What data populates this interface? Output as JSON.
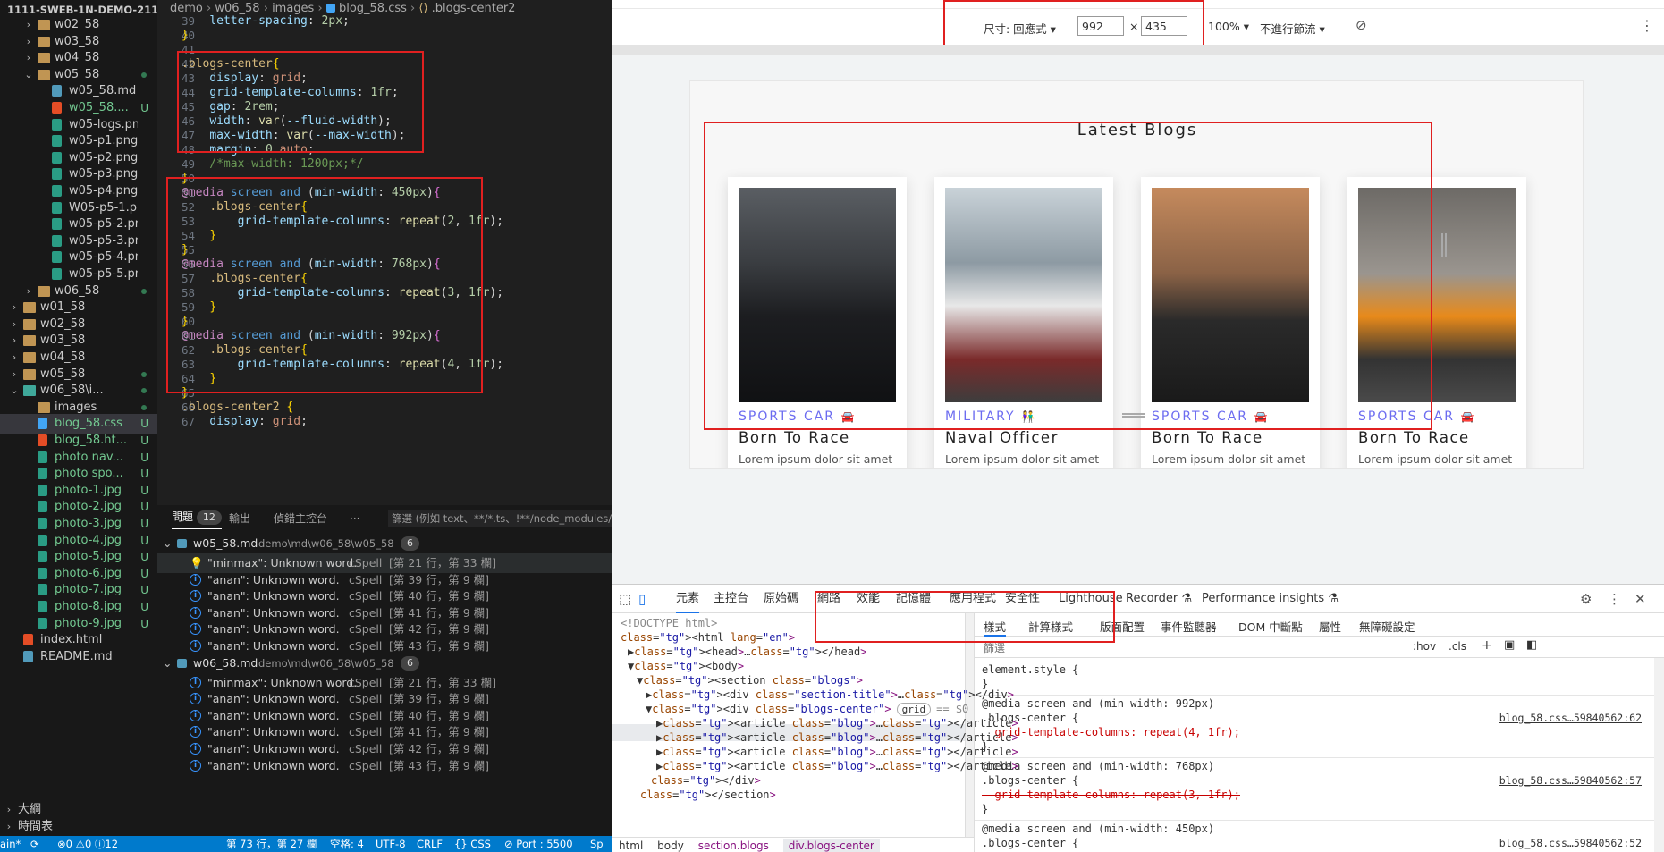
{
  "vscode": {
    "explorer": {
      "root": "1111-SWEB-1N-DEMO-211...",
      "items": [
        {
          "label": "w02_58",
          "type": "folder",
          "depth": 2,
          "collapsed": true
        },
        {
          "label": "w03_58",
          "type": "folder",
          "depth": 2,
          "collapsed": true
        },
        {
          "label": "w04_58",
          "type": "folder",
          "depth": 2,
          "collapsed": true
        },
        {
          "label": "w05_58",
          "type": "folder",
          "depth": 2,
          "collapsed": false,
          "dot": true
        },
        {
          "label": "w05_58.md",
          "type": "md",
          "depth": 3
        },
        {
          "label": "w05_58....",
          "type": "file-red",
          "depth": 3,
          "status": "U"
        },
        {
          "label": "w05-logs.png",
          "type": "png",
          "depth": 3
        },
        {
          "label": "w05-p1.png",
          "type": "png",
          "depth": 3
        },
        {
          "label": "w05-p2.png",
          "type": "png",
          "depth": 3
        },
        {
          "label": "w05-p3.png",
          "type": "png",
          "depth": 3
        },
        {
          "label": "w05-p4.png",
          "type": "png",
          "depth": 3
        },
        {
          "label": "W05-p5-1.png",
          "type": "png",
          "depth": 3
        },
        {
          "label": "w05-p5-2.png",
          "type": "png",
          "depth": 3
        },
        {
          "label": "w05-p5-3.png",
          "type": "png",
          "depth": 3
        },
        {
          "label": "w05-p5-4.png",
          "type": "png",
          "depth": 3
        },
        {
          "label": "w05-p5-5.png",
          "type": "png",
          "depth": 3
        },
        {
          "label": "w06_58",
          "type": "folder",
          "depth": 2,
          "collapsed": true,
          "dot": true
        },
        {
          "label": "w01_58",
          "type": "folder",
          "depth": 1,
          "collapsed": true
        },
        {
          "label": "w02_58",
          "type": "folder",
          "depth": 1,
          "collapsed": true
        },
        {
          "label": "w03_58",
          "type": "folder",
          "depth": 1,
          "collapsed": true
        },
        {
          "label": "w04_58",
          "type": "folder",
          "depth": 1,
          "collapsed": true
        },
        {
          "label": "w05_58",
          "type": "folder",
          "depth": 1,
          "collapsed": true,
          "dot": true
        },
        {
          "label": "w06_58\\i...",
          "type": "folder-img",
          "depth": 1,
          "collapsed": false,
          "dot": true
        },
        {
          "label": "images",
          "type": "folder",
          "depth": 2,
          "dot": true
        },
        {
          "label": "blog_58.css",
          "type": "css",
          "depth": 2,
          "status": "U",
          "selected": true
        },
        {
          "label": "blog_58.ht...",
          "type": "html",
          "depth": 2,
          "status": "U"
        },
        {
          "label": "photo nav...",
          "type": "jpg",
          "depth": 2,
          "status": "U"
        },
        {
          "label": "photo spo...",
          "type": "jpg",
          "depth": 2,
          "status": "U"
        },
        {
          "label": "photo-1.jpg",
          "type": "jpg",
          "depth": 2,
          "status": "U"
        },
        {
          "label": "photo-2.jpg",
          "type": "jpg",
          "depth": 2,
          "status": "U"
        },
        {
          "label": "photo-3.jpg",
          "type": "jpg",
          "depth": 2,
          "status": "U"
        },
        {
          "label": "photo-4.jpg",
          "type": "jpg",
          "depth": 2,
          "status": "U"
        },
        {
          "label": "photo-5.jpg",
          "type": "jpg",
          "depth": 2,
          "status": "U"
        },
        {
          "label": "photo-6.jpg",
          "type": "jpg",
          "depth": 2,
          "status": "U"
        },
        {
          "label": "photo-7.jpg",
          "type": "jpg",
          "depth": 2,
          "status": "U"
        },
        {
          "label": "photo-8.jpg",
          "type": "jpg",
          "depth": 2,
          "status": "U"
        },
        {
          "label": "photo-9.jpg",
          "type": "jpg",
          "depth": 2,
          "status": "U"
        },
        {
          "label": "index.html",
          "type": "html",
          "depth": 1
        },
        {
          "label": "README.md",
          "type": "md-i",
          "depth": 1
        }
      ],
      "outline": "大綱",
      "timeline": "時間表"
    },
    "breadcrumb": [
      "demo",
      "w06_58",
      "images",
      "blog_58.css",
      ".blogs-center2"
    ],
    "code": {
      "line_numbers": [
        "39",
        "40",
        "41",
        "42",
        "43",
        "44",
        "45",
        "46",
        "47",
        "48",
        "49",
        "50",
        "51",
        "52",
        "53",
        "54",
        "55",
        "56",
        "57",
        "58",
        "59",
        "60",
        "61",
        "62",
        "63",
        "64",
        "65",
        "66",
        "67"
      ],
      "lines": [
        "    letter-spacing: 2px;",
        "}",
        "",
        ".blogs-center{",
        "    display: grid;",
        "    grid-template-columns: 1fr;",
        "    gap: 2rem;",
        "    width: var(--fluid-width);",
        "    max-width: var(--max-width);",
        "    margin: 0 auto;",
        "    /*max-width: 1200px;*/",
        "}",
        "@media screen and (min-width: 450px){",
        "    .blogs-center{",
        "        grid-template-columns: repeat(2, 1fr);",
        "    }",
        "}",
        "@media screen and (min-width: 768px){",
        "    .blogs-center{",
        "        grid-template-columns: repeat(3, 1fr);",
        "    }",
        "}",
        "@media screen and (min-width: 992px){",
        "    .blogs-center{",
        "        grid-template-columns: repeat(4, 1fr);",
        "    }",
        "}",
        ".blogs-center2 {",
        "    display: grid;"
      ]
    },
    "problems": {
      "tabs": [
        "問題",
        "輸出",
        "偵錯主控台",
        "···"
      ],
      "count": "12",
      "filter_placeholder": "篩選 (例如 text、**/*.ts、!**/node_modules/**)",
      "groups": [
        {
          "file": "w05_58.md",
          "path": "demo\\md\\w06_58\\w05_58",
          "count": "6",
          "items": [
            {
              "text": "\"minmax\": Unknown word.",
              "src": "cSpell",
              "loc": "[第 21 行，第 33 欄]",
              "icon": "bulb"
            },
            {
              "text": "\"anan\": Unknown word.",
              "src": "cSpell",
              "loc": "[第 39 行，第 9 欄]",
              "icon": "info"
            },
            {
              "text": "\"anan\": Unknown word.",
              "src": "cSpell",
              "loc": "[第 40 行，第 9 欄]",
              "icon": "info"
            },
            {
              "text": "\"anan\": Unknown word.",
              "src": "cSpell",
              "loc": "[第 41 行，第 9 欄]",
              "icon": "info"
            },
            {
              "text": "\"anan\": Unknown word.",
              "src": "cSpell",
              "loc": "[第 42 行，第 9 欄]",
              "icon": "info"
            },
            {
              "text": "\"anan\": Unknown word.",
              "src": "cSpell",
              "loc": "[第 43 行，第 9 欄]",
              "icon": "info"
            }
          ]
        },
        {
          "file": "w06_58.md",
          "path": "demo\\md\\w06_58\\w05_58",
          "count": "6",
          "items": [
            {
              "text": "\"minmax\": Unknown word.",
              "src": "cSpell",
              "loc": "[第 21 行，第 33 欄]",
              "icon": "info"
            },
            {
              "text": "\"anan\": Unknown word.",
              "src": "cSpell",
              "loc": "[第 39 行，第 9 欄]",
              "icon": "info"
            },
            {
              "text": "\"anan\": Unknown word.",
              "src": "cSpell",
              "loc": "[第 40 行，第 9 欄]",
              "icon": "info"
            },
            {
              "text": "\"anan\": Unknown word.",
              "src": "cSpell",
              "loc": "[第 41 行，第 9 欄]",
              "icon": "info"
            },
            {
              "text": "\"anan\": Unknown word.",
              "src": "cSpell",
              "loc": "[第 42 行，第 9 欄]",
              "icon": "info"
            },
            {
              "text": "\"anan\": Unknown word.",
              "src": "cSpell",
              "loc": "[第 43 行，第 9 欄]",
              "icon": "info"
            }
          ]
        }
      ]
    },
    "statusbar": {
      "branch": "ain*",
      "errors": "0",
      "warnings": "0",
      "infos": "12",
      "cursor": "第 73 行，第 27 欄",
      "indent": "空格: 4",
      "encoding": "UTF-8",
      "eol": "CRLF",
      "lang": "CSS",
      "port": "Port : 5500",
      "extra": "Sp"
    }
  },
  "browser": {
    "device_toolbar": {
      "dimensions_label": "尺寸: 回應式",
      "width": "992",
      "height": "435",
      "times": "×",
      "zoom": "100%",
      "throttle": "不進行節流"
    },
    "page": {
      "title": "Latest Blogs",
      "cards": [
        {
          "category": "SPORTS CAR",
          "category_icon": "car-icon",
          "title": "Born To Race",
          "desc": "Lorem ipsum dolor sit amet",
          "photo": "black-sports-car-photo"
        },
        {
          "category": "MILITARY",
          "category_icon": "people-icon",
          "title": "Naval Officer",
          "desc": "Lorem ipsum dolor sit amet",
          "photo": "naval-officers-photo"
        },
        {
          "category": "SPORTS CAR",
          "category_icon": "car-icon",
          "title": "Born To Race",
          "desc": "Lorem ipsum dolor sit amet",
          "photo": "muscle-car-photo"
        },
        {
          "category": "SPORTS CAR",
          "category_icon": "car-icon",
          "title": "Born To Race",
          "desc": "Lorem ipsum dolor sit amet",
          "photo": "orange-lamborghini-photo"
        }
      ]
    },
    "devtools": {
      "tabs": [
        "元素",
        "主控台",
        "原始碼",
        "網路",
        "效能",
        "記憶體",
        "應用程式",
        "安全性",
        "Lighthouse",
        "Recorder",
        "Performance insights"
      ],
      "active_tab": "元素",
      "dom": [
        "<!DOCTYPE html>",
        "<html lang=\"en\">",
        "▶<head>…</head>",
        "▼<body>",
        "▼<section class=\"blogs\">",
        "▶<div class=\"section-title\">…</div>",
        "▼<div class=\"blogs-center\">",
        "▶<article class=\"blog\">…</article>",
        "▶<article class=\"blog\">…</article>",
        "▶<article class=\"blog\">…</article>",
        "▶<article class=\"blog\">…</article>",
        "</div>",
        "</section>"
      ],
      "grid_badge": "grid",
      "selected_marker": "== $0",
      "breadcrumb": [
        "html",
        "body",
        "section.blogs",
        "div.blogs-center"
      ],
      "styles_tabs": [
        "樣式",
        "計算樣式",
        "版面配置",
        "事件監聽器",
        "DOM 中斷點",
        "屬性",
        "無障礙設定"
      ],
      "filter_placeholder": "篩選",
      "hov": ":hov",
      "cls": ".cls",
      "rules": [
        {
          "selector": "element.style {",
          "body": "}",
          "source": ""
        },
        {
          "media": "@media screen and (min-width: 992px)",
          "selector": ".blogs-center {",
          "decl": "grid-template-columns: repeat(4, 1fr);",
          "source": "blog_58.css…59840562:62",
          "struck": false
        },
        {
          "media": "@media screen and (min-width: 768px)",
          "selector": ".blogs-center {",
          "decl": "grid-template-columns: repeat(3, 1fr);",
          "source": "blog_58.css…59840562:57",
          "struck": true
        },
        {
          "media": "@media screen and (min-width: 450px)",
          "selector": ".blogs-center {",
          "decl": "",
          "source": "blog_58.css…59840562:52",
          "struck": true
        }
      ]
    }
  },
  "colors": {
    "annotation_red": "#e02020",
    "accent_blue": "#6c6cf0",
    "vscode_status": "#007acc"
  }
}
